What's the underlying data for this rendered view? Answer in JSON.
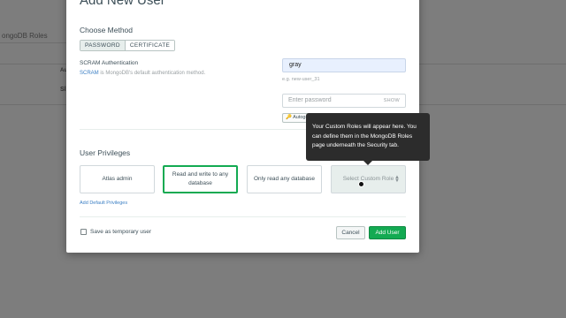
{
  "background": {
    "roles_label": "ongoDB Roles",
    "col_label": "Au",
    "row_label": "Sl"
  },
  "modal": {
    "title": "Add New User",
    "choose_method": {
      "heading": "Choose Method",
      "options": [
        "PASSWORD",
        "CERTIFICATE"
      ],
      "selected": "PASSWORD"
    },
    "scram": {
      "title": "SCRAM Authentication",
      "desc_link": "SCRAM",
      "desc_rest": " is MongoDB's default authentication method."
    },
    "username": {
      "value": "gray",
      "hint": "e.g. new-user_31"
    },
    "password": {
      "placeholder": "Enter password",
      "show_label": "SHOW"
    },
    "autogenerate_label": "Autogenerate Secure Password",
    "privileges": {
      "heading": "User Privileges",
      "options": [
        {
          "label": "Atlas admin",
          "selected": false
        },
        {
          "label": "Read and write to any database",
          "selected": true
        },
        {
          "label": "Only read any database",
          "selected": false
        },
        {
          "label": "Select Custom Role",
          "selected": false
        }
      ],
      "add_default_link": "Add Default Privileges"
    },
    "temporary_user_label": "Save as temporary user",
    "cancel_label": "Cancel",
    "add_user_label": "Add User"
  },
  "tooltip": {
    "text": "Your Custom Roles will appear here. You can define them in the MongoDB Roles page underneath the Security tab."
  },
  "colors": {
    "accent_green": "#13aa52",
    "link_blue": "#3b7fc4",
    "tooltip_bg": "#2c2c2c"
  }
}
